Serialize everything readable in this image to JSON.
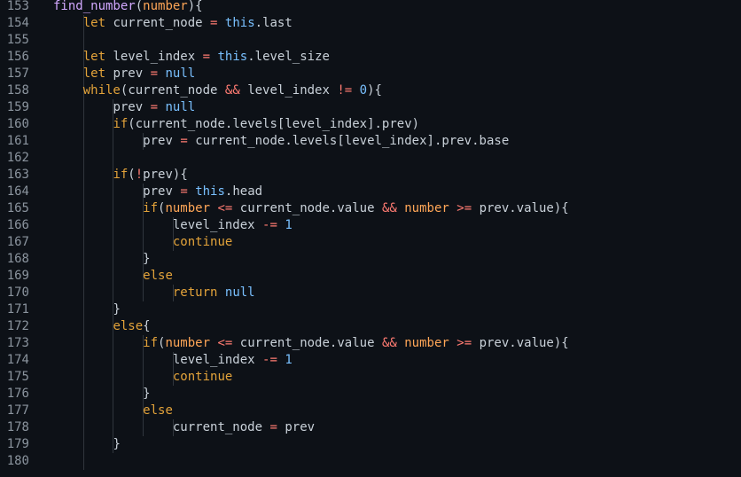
{
  "colors": {
    "background": "#0d1117",
    "gutter_text": "#8b949e",
    "text": "#c9d1d9",
    "function": "#d2a8ff",
    "keyword": "#e3a33a",
    "operator": "#ff7b72",
    "constant": "#79c0ff",
    "parameter": "#ffa657",
    "indent_guide": "#30363d"
  },
  "editor": {
    "lines": [
      {
        "number": "153",
        "indent": 1,
        "tokens": [
          {
            "t": "fn",
            "v": "find_number"
          },
          {
            "t": "punc",
            "v": "("
          },
          {
            "t": "param",
            "v": "number"
          },
          {
            "t": "punc",
            "v": "){"
          }
        ]
      },
      {
        "number": "154",
        "indent": 2,
        "tokens": [
          {
            "t": "kw2",
            "v": "let"
          },
          {
            "t": "ws",
            "v": " "
          },
          {
            "t": "id",
            "v": "current_node"
          },
          {
            "t": "ws",
            "v": " "
          },
          {
            "t": "op",
            "v": "="
          },
          {
            "t": "ws",
            "v": " "
          },
          {
            "t": "this",
            "v": "this"
          },
          {
            "t": "punc",
            "v": "."
          },
          {
            "t": "id",
            "v": "last"
          }
        ]
      },
      {
        "number": "155",
        "indent": 2,
        "tokens": []
      },
      {
        "number": "156",
        "indent": 2,
        "tokens": [
          {
            "t": "kw2",
            "v": "let"
          },
          {
            "t": "ws",
            "v": " "
          },
          {
            "t": "id",
            "v": "level_index"
          },
          {
            "t": "ws",
            "v": " "
          },
          {
            "t": "op",
            "v": "="
          },
          {
            "t": "ws",
            "v": " "
          },
          {
            "t": "this",
            "v": "this"
          },
          {
            "t": "punc",
            "v": "."
          },
          {
            "t": "id",
            "v": "level_size"
          }
        ]
      },
      {
        "number": "157",
        "indent": 2,
        "tokens": [
          {
            "t": "kw2",
            "v": "let"
          },
          {
            "t": "ws",
            "v": " "
          },
          {
            "t": "id",
            "v": "prev"
          },
          {
            "t": "ws",
            "v": " "
          },
          {
            "t": "op",
            "v": "="
          },
          {
            "t": "ws",
            "v": " "
          },
          {
            "t": "lit",
            "v": "null"
          }
        ]
      },
      {
        "number": "158",
        "indent": 2,
        "tokens": [
          {
            "t": "kw2",
            "v": "while"
          },
          {
            "t": "punc",
            "v": "("
          },
          {
            "t": "id",
            "v": "current_node"
          },
          {
            "t": "ws",
            "v": " "
          },
          {
            "t": "op",
            "v": "&&"
          },
          {
            "t": "ws",
            "v": " "
          },
          {
            "t": "id",
            "v": "level_index"
          },
          {
            "t": "ws",
            "v": " "
          },
          {
            "t": "op",
            "v": "!="
          },
          {
            "t": "ws",
            "v": " "
          },
          {
            "t": "num",
            "v": "0"
          },
          {
            "t": "punc",
            "v": "){"
          }
        ]
      },
      {
        "number": "159",
        "indent": 3,
        "tokens": [
          {
            "t": "id",
            "v": "prev"
          },
          {
            "t": "ws",
            "v": " "
          },
          {
            "t": "op",
            "v": "="
          },
          {
            "t": "ws",
            "v": " "
          },
          {
            "t": "lit",
            "v": "null"
          }
        ]
      },
      {
        "number": "160",
        "indent": 3,
        "tokens": [
          {
            "t": "kw2",
            "v": "if"
          },
          {
            "t": "punc",
            "v": "("
          },
          {
            "t": "id",
            "v": "current_node"
          },
          {
            "t": "punc",
            "v": "."
          },
          {
            "t": "id",
            "v": "levels"
          },
          {
            "t": "punc",
            "v": "["
          },
          {
            "t": "id",
            "v": "level_index"
          },
          {
            "t": "punc",
            "v": "]."
          },
          {
            "t": "id",
            "v": "prev"
          },
          {
            "t": "punc",
            "v": ")"
          }
        ]
      },
      {
        "number": "161",
        "indent": 4,
        "tokens": [
          {
            "t": "id",
            "v": "prev"
          },
          {
            "t": "ws",
            "v": " "
          },
          {
            "t": "op",
            "v": "="
          },
          {
            "t": "ws",
            "v": " "
          },
          {
            "t": "id",
            "v": "current_node"
          },
          {
            "t": "punc",
            "v": "."
          },
          {
            "t": "id",
            "v": "levels"
          },
          {
            "t": "punc",
            "v": "["
          },
          {
            "t": "id",
            "v": "level_index"
          },
          {
            "t": "punc",
            "v": "]."
          },
          {
            "t": "id",
            "v": "prev"
          },
          {
            "t": "punc",
            "v": "."
          },
          {
            "t": "id",
            "v": "base"
          }
        ]
      },
      {
        "number": "162",
        "indent": 3,
        "tokens": []
      },
      {
        "number": "163",
        "indent": 3,
        "tokens": [
          {
            "t": "kw2",
            "v": "if"
          },
          {
            "t": "punc",
            "v": "("
          },
          {
            "t": "op",
            "v": "!"
          },
          {
            "t": "id",
            "v": "prev"
          },
          {
            "t": "punc",
            "v": "){"
          }
        ]
      },
      {
        "number": "164",
        "indent": 4,
        "tokens": [
          {
            "t": "id",
            "v": "prev"
          },
          {
            "t": "ws",
            "v": " "
          },
          {
            "t": "op",
            "v": "="
          },
          {
            "t": "ws",
            "v": " "
          },
          {
            "t": "this",
            "v": "this"
          },
          {
            "t": "punc",
            "v": "."
          },
          {
            "t": "id",
            "v": "head"
          }
        ]
      },
      {
        "number": "165",
        "indent": 4,
        "tokens": [
          {
            "t": "kw2",
            "v": "if"
          },
          {
            "t": "punc",
            "v": "("
          },
          {
            "t": "param",
            "v": "number"
          },
          {
            "t": "ws",
            "v": " "
          },
          {
            "t": "op",
            "v": "<="
          },
          {
            "t": "ws",
            "v": " "
          },
          {
            "t": "id",
            "v": "current_node"
          },
          {
            "t": "punc",
            "v": "."
          },
          {
            "t": "id",
            "v": "value"
          },
          {
            "t": "ws",
            "v": " "
          },
          {
            "t": "op",
            "v": "&&"
          },
          {
            "t": "ws",
            "v": " "
          },
          {
            "t": "param",
            "v": "number"
          },
          {
            "t": "ws",
            "v": " "
          },
          {
            "t": "op",
            "v": ">="
          },
          {
            "t": "ws",
            "v": " "
          },
          {
            "t": "id",
            "v": "prev"
          },
          {
            "t": "punc",
            "v": "."
          },
          {
            "t": "id",
            "v": "value"
          },
          {
            "t": "punc",
            "v": "){"
          }
        ]
      },
      {
        "number": "166",
        "indent": 5,
        "tokens": [
          {
            "t": "id",
            "v": "level_index"
          },
          {
            "t": "ws",
            "v": " "
          },
          {
            "t": "op",
            "v": "-="
          },
          {
            "t": "ws",
            "v": " "
          },
          {
            "t": "num",
            "v": "1"
          }
        ]
      },
      {
        "number": "167",
        "indent": 5,
        "tokens": [
          {
            "t": "kw2",
            "v": "continue"
          }
        ]
      },
      {
        "number": "168",
        "indent": 4,
        "tokens": [
          {
            "t": "punc",
            "v": "}"
          }
        ]
      },
      {
        "number": "169",
        "indent": 4,
        "tokens": [
          {
            "t": "kw2",
            "v": "else"
          }
        ]
      },
      {
        "number": "170",
        "indent": 5,
        "tokens": [
          {
            "t": "kw2",
            "v": "return"
          },
          {
            "t": "ws",
            "v": " "
          },
          {
            "t": "lit",
            "v": "null"
          }
        ]
      },
      {
        "number": "171",
        "indent": 3,
        "tokens": [
          {
            "t": "punc",
            "v": "}"
          }
        ]
      },
      {
        "number": "172",
        "indent": 3,
        "tokens": [
          {
            "t": "kw2",
            "v": "else"
          },
          {
            "t": "punc",
            "v": "{"
          }
        ]
      },
      {
        "number": "173",
        "indent": 4,
        "tokens": [
          {
            "t": "kw2",
            "v": "if"
          },
          {
            "t": "punc",
            "v": "("
          },
          {
            "t": "param",
            "v": "number"
          },
          {
            "t": "ws",
            "v": " "
          },
          {
            "t": "op",
            "v": "<="
          },
          {
            "t": "ws",
            "v": " "
          },
          {
            "t": "id",
            "v": "current_node"
          },
          {
            "t": "punc",
            "v": "."
          },
          {
            "t": "id",
            "v": "value"
          },
          {
            "t": "ws",
            "v": " "
          },
          {
            "t": "op",
            "v": "&&"
          },
          {
            "t": "ws",
            "v": " "
          },
          {
            "t": "param",
            "v": "number"
          },
          {
            "t": "ws",
            "v": " "
          },
          {
            "t": "op",
            "v": ">="
          },
          {
            "t": "ws",
            "v": " "
          },
          {
            "t": "id",
            "v": "prev"
          },
          {
            "t": "punc",
            "v": "."
          },
          {
            "t": "id",
            "v": "value"
          },
          {
            "t": "punc",
            "v": "){"
          }
        ]
      },
      {
        "number": "174",
        "indent": 5,
        "tokens": [
          {
            "t": "id",
            "v": "level_index"
          },
          {
            "t": "ws",
            "v": " "
          },
          {
            "t": "op",
            "v": "-="
          },
          {
            "t": "ws",
            "v": " "
          },
          {
            "t": "num",
            "v": "1"
          }
        ]
      },
      {
        "number": "175",
        "indent": 5,
        "tokens": [
          {
            "t": "kw2",
            "v": "continue"
          }
        ]
      },
      {
        "number": "176",
        "indent": 4,
        "tokens": [
          {
            "t": "punc",
            "v": "}"
          }
        ]
      },
      {
        "number": "177",
        "indent": 4,
        "tokens": [
          {
            "t": "kw2",
            "v": "else"
          }
        ]
      },
      {
        "number": "178",
        "indent": 5,
        "tokens": [
          {
            "t": "id",
            "v": "current_node"
          },
          {
            "t": "ws",
            "v": " "
          },
          {
            "t": "op",
            "v": "="
          },
          {
            "t": "ws",
            "v": " "
          },
          {
            "t": "id",
            "v": "prev"
          }
        ]
      },
      {
        "number": "179",
        "indent": 3,
        "tokens": [
          {
            "t": "punc",
            "v": "}"
          }
        ]
      },
      {
        "number": "180",
        "indent": 2,
        "tokens": []
      }
    ]
  }
}
